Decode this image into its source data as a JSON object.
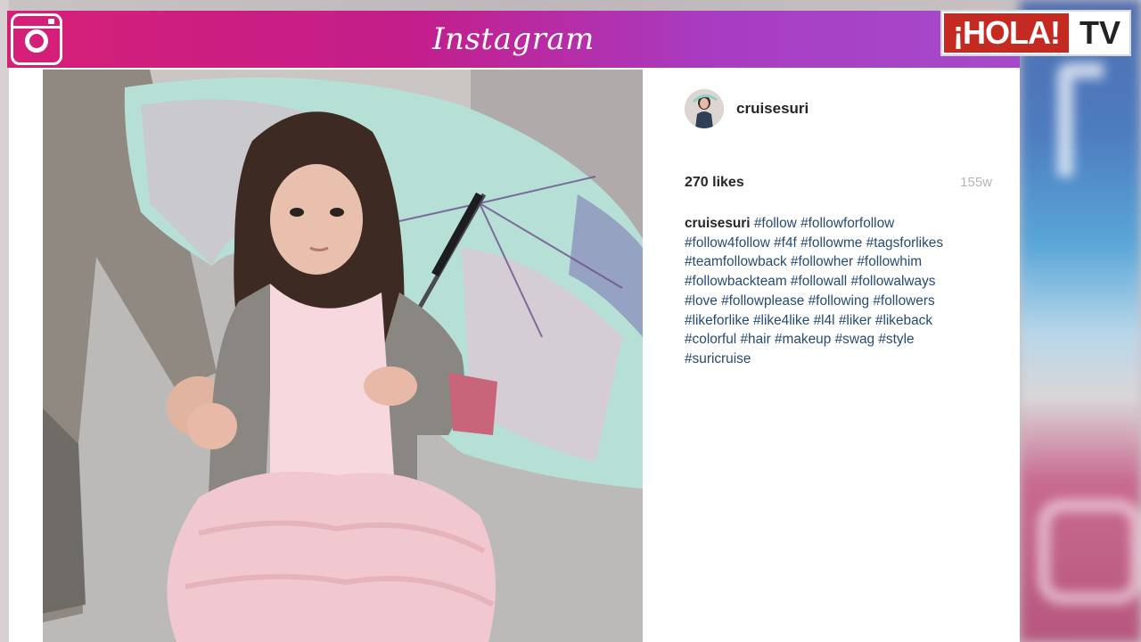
{
  "header": {
    "app_wordmark": "Instagram",
    "brand_logo_red": "¡HOLA!",
    "brand_logo_tv": "TV",
    "bar_gradient_start": "#d61f77",
    "bar_gradient_end": "#a64acb",
    "logo_red": "#c52a22"
  },
  "post": {
    "username": "cruisesuri",
    "likes": "270 likes",
    "time_ago": "155w",
    "caption_user": "cruisesuri",
    "hashtags": [
      "#follow",
      "#followforfollow",
      "#follow4follow",
      "#f4f",
      "#followme",
      "#tagsforlikes",
      "#teamfollowback",
      "#followher",
      "#followhim",
      "#followbackteam",
      "#followall",
      "#followalways",
      "#love",
      "#followplease",
      "#following",
      "#followers",
      "#likeforlike",
      "#like4like",
      "#l4l",
      "#liker",
      "#likeback",
      "#colorful",
      "#hair",
      "#makeup",
      "#swag",
      "#style",
      "#suricruise"
    ],
    "caption_lines": [
      [
        0,
        1
      ],
      [
        2,
        3,
        4,
        5
      ],
      [
        6,
        7,
        8
      ],
      [
        9,
        10,
        11
      ],
      [
        12,
        13,
        14,
        15
      ],
      [
        16,
        17,
        18,
        19,
        20
      ],
      [
        21,
        22,
        23,
        24,
        25
      ],
      [
        26
      ]
    ]
  },
  "icons": {
    "camera": "instagram-camera-icon",
    "background_social": [
      "facebook-icon",
      "twitter-icon",
      "instagram-icon"
    ]
  }
}
